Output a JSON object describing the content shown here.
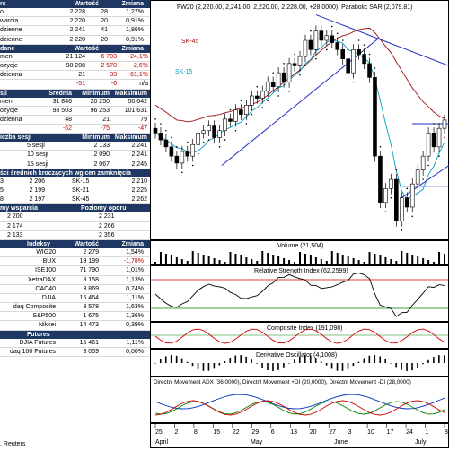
{
  "left": {
    "quotes": {
      "headers": [
        "rs",
        "Wartość",
        "Zmiana"
      ],
      "rows": [
        [
          "o",
          "2 228",
          "28",
          "1,27%"
        ],
        [
          "warcia",
          "2 220",
          "20",
          "0,91%"
        ],
        [
          "dzienne",
          "2 241",
          "41",
          "1,86%"
        ],
        [
          "dzienne",
          "2 220",
          "20",
          "0,91%"
        ]
      ]
    },
    "data": {
      "headers": [
        "dane",
        "Wartość",
        "Zmiana"
      ],
      "rows": [
        [
          "men",
          "21 124",
          "-6 703",
          "-24,1%"
        ],
        [
          "ozycje",
          "98 208",
          "-2 570",
          "-2,6%"
        ],
        [
          "dzienna",
          "21",
          "-33",
          "-61,1%"
        ],
        [
          "",
          "-51",
          "-6",
          "n/a"
        ]
      ]
    },
    "stats": {
      "headers": [
        "sji",
        "Średnia",
        "Minimum",
        "Maksimum"
      ],
      "rows": [
        [
          "men",
          "31 846",
          "20 250",
          "50 642"
        ],
        [
          "ozycje",
          "98 503",
          "96 253",
          "101 631"
        ],
        [
          "dzienna",
          "48",
          "21",
          "79"
        ],
        [
          "",
          "-62",
          "-75",
          "-47"
        ]
      ]
    },
    "sessions": {
      "headers": [
        "iczba sesji",
        "Minimum",
        "Maksimum"
      ],
      "rows": [
        [
          "5 sesji",
          "2 133",
          "2 241"
        ],
        [
          "10 sesji",
          "2 090",
          "2 241"
        ],
        [
          "15 sesji",
          "2 067",
          "2 245"
        ]
      ]
    },
    "ma": {
      "header": "ści średnich kroczących wg cen zamknięcia",
      "rows": [
        [
          "3",
          "2 206",
          "SK-15",
          "2 210"
        ],
        [
          "5",
          "2 199",
          "SK-21",
          "2 225"
        ],
        [
          "8",
          "2 197",
          "SK-45",
          "2 262"
        ]
      ]
    },
    "levels": {
      "headers": [
        "my wsparcia",
        "Poziomy oporu"
      ],
      "rows": [
        [
          "2 200",
          "2 231"
        ],
        [
          "2 174",
          "2 266"
        ],
        [
          "2 133",
          "2 356"
        ]
      ]
    },
    "indices": {
      "headers": [
        "Indeksy",
        "Wartość",
        "Zmiana"
      ],
      "rows": [
        [
          "WIG20",
          "2 279",
          "1,54%"
        ],
        [
          "BUX",
          "19 199",
          "-1,78%"
        ],
        [
          "ISE100",
          "71 790",
          "1,01%"
        ],
        [
          "XetraDAX",
          "8 158",
          "1,13%"
        ],
        [
          "CAC40",
          "3 869",
          "0,74%"
        ],
        [
          "DJIA",
          "15 464",
          "1,11%"
        ],
        [
          "daq Composite",
          "3 578",
          "1,63%"
        ],
        [
          "S&P500",
          "1 675",
          "1,36%"
        ],
        [
          "Nikkei",
          "14 473",
          "0,39%"
        ]
      ]
    },
    "futures": {
      "header": "Futures",
      "rows": [
        [
          "DJIA Futures",
          "15 461",
          "1,11%"
        ],
        [
          "daq 100 Futures",
          "3 059",
          "0,00%"
        ]
      ]
    },
    "footer": ". Reuters"
  },
  "chart": {
    "title": "FW20 (2,220.00, 2,241.00, 2,220.00, 2,228.00, +28.0000), Parabolic SAR (2,079.81)",
    "sk45_label": "SK-45",
    "sk15_label": "SK-15",
    "volume_label": "Volume (21,504)",
    "rsi_label": "Relative Strength Index (62,2599)",
    "ci_label": "Composite Index (191,098)",
    "do_label": "Derivative Oscillator (4,1008)",
    "dmi_label": "Directnl Movement ADX (36,0000), Directnl Movement +DI (20,0000), Directnl Movement -DI (28,0000)",
    "x_ticks": [
      "25",
      "2",
      "8",
      "15",
      "22",
      "29",
      "6",
      "13",
      "20",
      "27",
      "3",
      "10",
      "17",
      "24",
      "1",
      "8"
    ],
    "months": [
      "April",
      "May",
      "June",
      "July"
    ],
    "colors": {
      "candle_up": "#ffffff",
      "candle_down": "#000000",
      "trend": "#2030c0",
      "sk45": "#a01010",
      "sk15": "#00a0c0",
      "rsi": "#000000",
      "ci": "#d00000",
      "osc": "#000000",
      "adx": "#0030c0",
      "plus_di": "#008000",
      "minus_di": "#d00000",
      "header": "#1f3863"
    }
  },
  "chart_data": {
    "type": "candlestick",
    "closes_approx": [
      2200,
      2185,
      2170,
      2150,
      2135,
      2160,
      2150,
      2175,
      2200,
      2205,
      2215,
      2190,
      2205,
      2230,
      2225,
      2250,
      2240,
      2260,
      2280,
      2275,
      2290,
      2310,
      2300,
      2330,
      2310,
      2350,
      2345,
      2365,
      2400,
      2380,
      2420,
      2400,
      2410,
      2395,
      2380,
      2360,
      2330,
      2380,
      2370,
      2350,
      2320,
      2150,
      2050,
      2080,
      2100,
      2010,
      2060,
      2040,
      2090,
      2120,
      2150,
      2200,
      2170,
      2210,
      2228
    ]
  }
}
